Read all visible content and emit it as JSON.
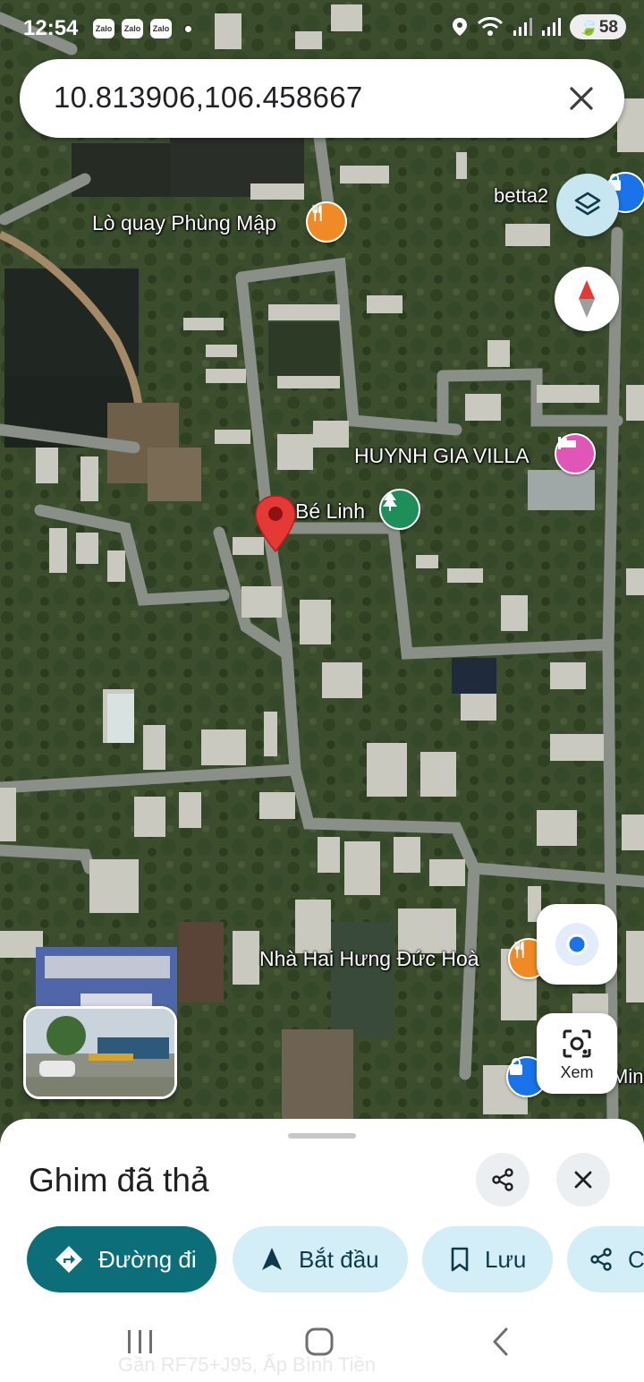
{
  "status_bar": {
    "time": "12:54",
    "notification_icons": [
      "Zalo",
      "Zalo",
      "Zalo"
    ],
    "battery": "58"
  },
  "search": {
    "query": "10.813906,106.458667"
  },
  "map": {
    "places": [
      {
        "name": "Lò quay Phùng Mập",
        "icon": "restaurant-icon",
        "color": "#f08a24"
      },
      {
        "name": "HUYNH GIA VILLA",
        "icon": "hotel-icon",
        "color": "#e056b6"
      },
      {
        "name": "Bé Linh",
        "icon": "park-icon",
        "color": "#1e8e5a"
      },
      {
        "name": "Nhà Hai Hưng Đức Hoà",
        "icon": "restaurant-icon",
        "color": "#f08a24"
      },
      {
        "name": "betta2",
        "icon": "shopping-icon",
        "color": "#1a73e8"
      }
    ],
    "edge_labels": [
      "Minh"
    ],
    "pin_color": "#e53935"
  },
  "controls": {
    "layers": "layers-icon",
    "compass": "compass-icon",
    "my_location": "my-location-icon",
    "lens_label": "Xem"
  },
  "sheet": {
    "title": "Ghim đã thả",
    "actions": [
      {
        "label": "Đường đi",
        "icon": "directions-icon",
        "primary": true
      },
      {
        "label": "Bắt đầu",
        "icon": "navigation-icon",
        "primary": false
      },
      {
        "label": "Lưu",
        "icon": "bookmark-icon",
        "primary": false
      },
      {
        "label": "C",
        "icon": "share-icon",
        "primary": false
      }
    ],
    "address_preview": "Gần RF75+J95, Ấp Bình Tiền"
  },
  "colors": {
    "accent": "#0b6e78",
    "chip_bg": "#d3eef7"
  }
}
